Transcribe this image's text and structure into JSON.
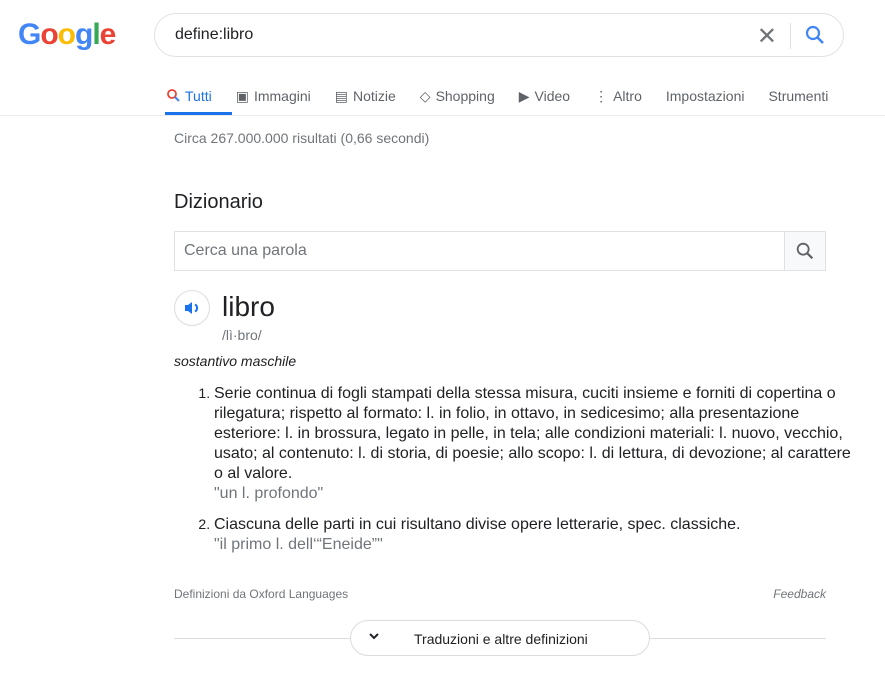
{
  "logo": "Google",
  "search": {
    "query": "define:libro"
  },
  "tabs": [
    {
      "label": "Tutti",
      "icon": "search-icon"
    },
    {
      "label": "Immagini",
      "icon": "image-icon"
    },
    {
      "label": "Notizie",
      "icon": "news-icon"
    },
    {
      "label": "Shopping",
      "icon": "tag-icon"
    },
    {
      "label": "Video",
      "icon": "play-icon"
    },
    {
      "label": "Altro",
      "icon": "more-icon"
    },
    {
      "label": "Impostazioni"
    },
    {
      "label": "Strumenti"
    }
  ],
  "stats": "Circa 267.000.000 risultati (0,66 secondi)",
  "dictionary": {
    "title": "Dizionario",
    "placeholder": "Cerca una parola",
    "word": "libro",
    "phonetic": "/lì·bro/",
    "pos": "sostantivo maschile",
    "definitions": [
      {
        "text": "Serie continua di fogli stampati della stessa misura, cuciti insieme e forniti di copertina o rilegatura; rispetto al formato: l. in folio, in ottavo, in sedicesimo; alla presentazione esteriore: l. in brossura, legato in pelle, in tela; alle condizioni materiali: l. nuovo, vecchio, usato; al contenuto: l. di storia, di poesie; allo scopo: l. di lettura, di devozione; al carattere o al valore.",
        "example": "\"un l. profondo\""
      },
      {
        "text": "Ciascuna delle parti in cui risultano divise opere letterarie, spec. classiche.",
        "example": "\"il primo l. dell‘“Eneide”\""
      }
    ],
    "source": "Definizioni da Oxford Languages",
    "feedback": "Feedback",
    "more": "Traduzioni e altre definizioni"
  }
}
